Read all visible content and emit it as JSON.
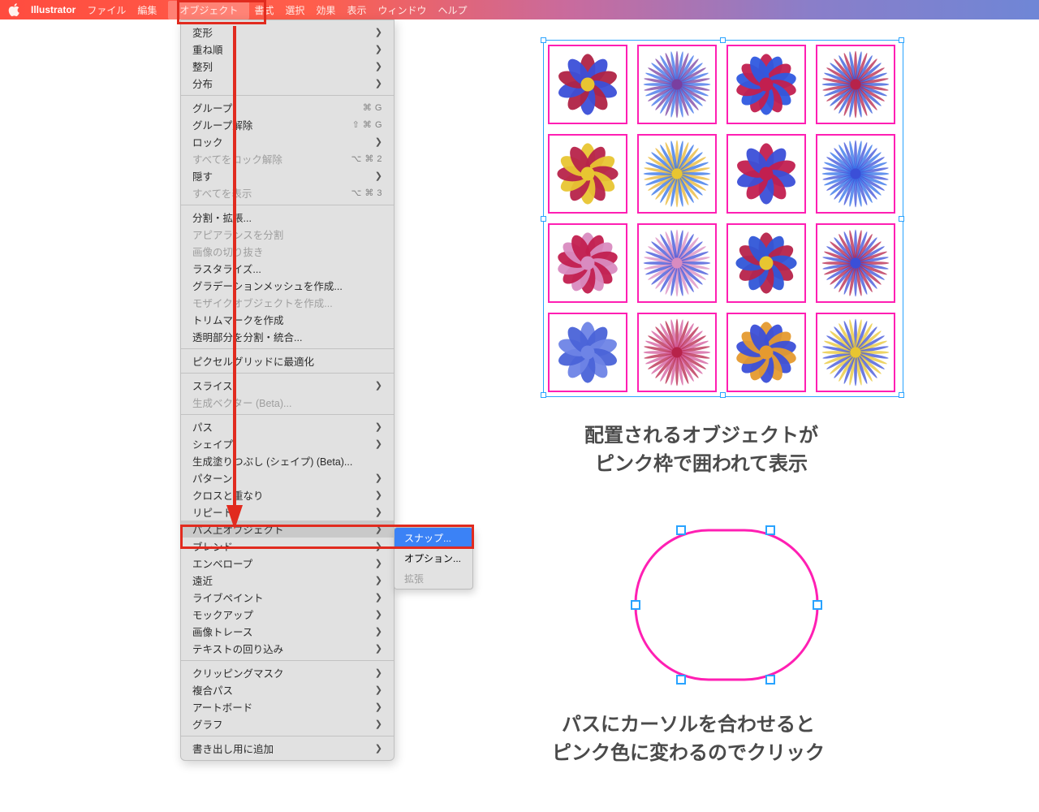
{
  "menubar": {
    "app": "Illustrator",
    "items": [
      "ファイル",
      "編集",
      "オブジェクト",
      "書式",
      "選択",
      "効果",
      "表示",
      "ウィンドウ",
      "ヘルプ"
    ],
    "selected_index": 2
  },
  "dropdown": {
    "groups": [
      [
        {
          "label": "変形",
          "sub": true
        },
        {
          "label": "重ね順",
          "sub": true
        },
        {
          "label": "整列",
          "sub": true
        },
        {
          "label": "分布",
          "sub": true
        }
      ],
      [
        {
          "label": "グループ",
          "shortcut": "⌘ G"
        },
        {
          "label": "グループ解除",
          "shortcut": "⇧ ⌘ G"
        },
        {
          "label": "ロック",
          "sub": true
        },
        {
          "label": "すべてをロック解除",
          "shortcut": "⌥ ⌘ 2",
          "disabled": true
        },
        {
          "label": "隠す",
          "sub": true
        },
        {
          "label": "すべてを表示",
          "shortcut": "⌥ ⌘ 3",
          "disabled": true
        }
      ],
      [
        {
          "label": "分割・拡張..."
        },
        {
          "label": "アピアランスを分割",
          "disabled": true
        },
        {
          "label": "画像の切り抜き",
          "disabled": true
        },
        {
          "label": "ラスタライズ..."
        },
        {
          "label": "グラデーションメッシュを作成..."
        },
        {
          "label": "モザイクオブジェクトを作成...",
          "disabled": true
        },
        {
          "label": "トリムマークを作成"
        },
        {
          "label": "透明部分を分割・統合..."
        }
      ],
      [
        {
          "label": "ピクセルグリッドに最適化"
        }
      ],
      [
        {
          "label": "スライス",
          "sub": true
        },
        {
          "label": "生成ベクター (Beta)...",
          "disabled": true
        }
      ],
      [
        {
          "label": "パス",
          "sub": true
        },
        {
          "label": "シェイプ",
          "sub": true
        },
        {
          "label": "生成塗りつぶし (シェイプ) (Beta)..."
        },
        {
          "label": "パターン",
          "sub": true
        },
        {
          "label": "クロスと重なり",
          "sub": true
        },
        {
          "label": "リピート",
          "sub": true
        },
        {
          "label": "パス上オブジェクト",
          "sub": true,
          "highlight": true
        },
        {
          "label": "ブレンド",
          "sub": true
        },
        {
          "label": "エンベロープ",
          "sub": true
        },
        {
          "label": "遠近",
          "sub": true
        },
        {
          "label": "ライブペイント",
          "sub": true
        },
        {
          "label": "モックアップ",
          "sub": true
        },
        {
          "label": "画像トレース",
          "sub": true
        },
        {
          "label": "テキストの回り込み",
          "sub": true
        }
      ],
      [
        {
          "label": "クリッピングマスク",
          "sub": true
        },
        {
          "label": "複合パス",
          "sub": true
        },
        {
          "label": "アートボード",
          "sub": true
        },
        {
          "label": "グラフ",
          "sub": true
        }
      ],
      [
        {
          "label": "書き出し用に追加",
          "sub": true
        }
      ]
    ]
  },
  "submenu": {
    "items": [
      {
        "label": "スナップ...",
        "highlight": true
      },
      {
        "label": "オプション..."
      },
      {
        "label": "拡張",
        "disabled": true
      }
    ]
  },
  "captions": {
    "top_line1": "配置されるオブジェクトが",
    "top_line2": "ピンク枠で囲われて表示",
    "bottom_line1": "パスにカーソルを合わせると",
    "bottom_line2": "ピンク色に変わるのでクリック"
  },
  "colors": {
    "highlight_red": "#e12b1f",
    "pink": "#ff1fb3",
    "selection_blue": "#29a3ff",
    "submenu_hi": "#3b82f6"
  }
}
